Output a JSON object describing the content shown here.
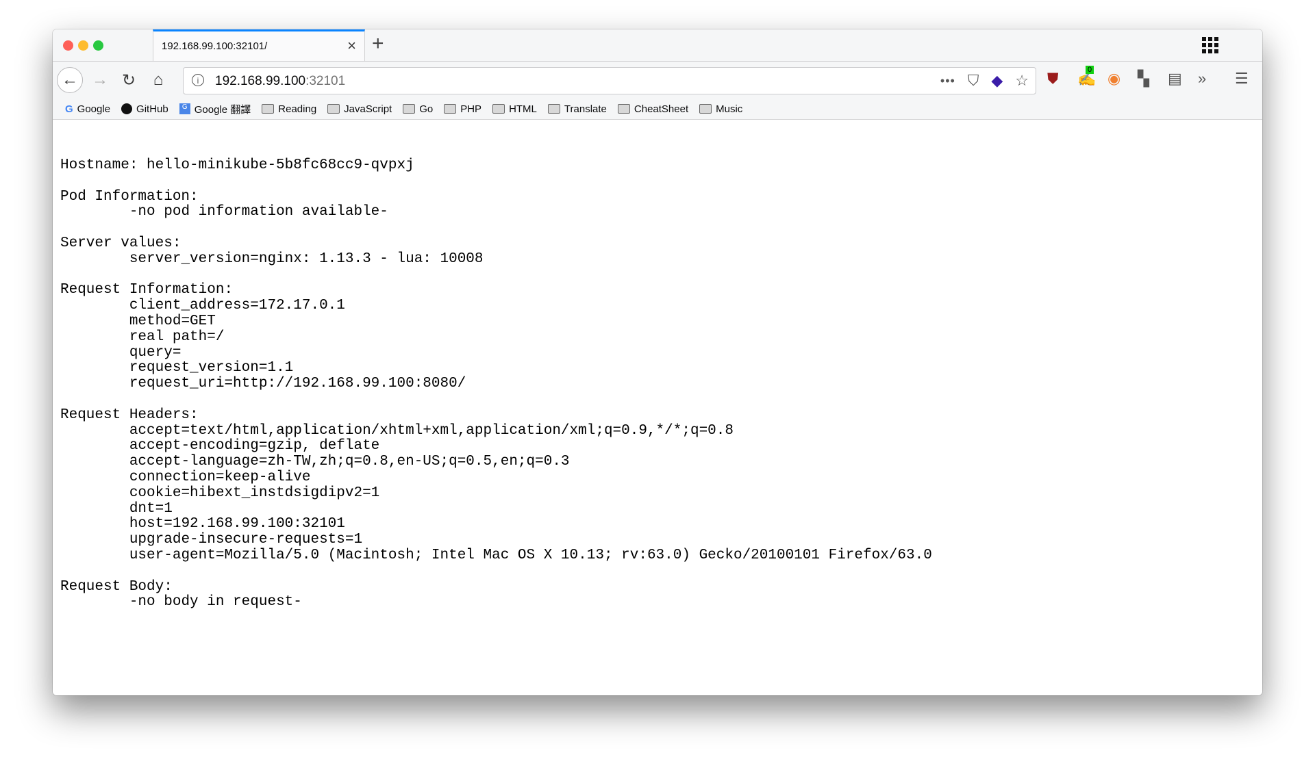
{
  "tab": {
    "title": "192.168.99.100:32101/"
  },
  "urlbar": {
    "host": "192.168.99.100",
    "port": ":32101"
  },
  "bookmarks": [
    "Google",
    "GitHub",
    "Google 翻譯",
    "Reading",
    "JavaScript",
    "Go",
    "PHP",
    "HTML",
    "Translate",
    "CheatSheet",
    "Music"
  ],
  "extension_badge": "0",
  "page": {
    "lines": [
      "Hostname: hello-minikube-5b8fc68cc9-qvpxj",
      "",
      "Pod Information:",
      "\t-no pod information available-",
      "",
      "Server values:",
      "\tserver_version=nginx: 1.13.3 - lua: 10008",
      "",
      "Request Information:",
      "\tclient_address=172.17.0.1",
      "\tmethod=GET",
      "\treal path=/",
      "\tquery=",
      "\trequest_version=1.1",
      "\trequest_uri=http://192.168.99.100:8080/",
      "",
      "Request Headers:",
      "\taccept=text/html,application/xhtml+xml,application/xml;q=0.9,*/*;q=0.8",
      "\taccept-encoding=gzip, deflate",
      "\taccept-language=zh-TW,zh;q=0.8,en-US;q=0.5,en;q=0.3",
      "\tconnection=keep-alive",
      "\tcookie=hibext_instdsigdipv2=1",
      "\tdnt=1",
      "\thost=192.168.99.100:32101",
      "\tupgrade-insecure-requests=1",
      "\tuser-agent=Mozilla/5.0 (Macintosh; Intel Mac OS X 10.13; rv:63.0) Gecko/20100101 Firefox/63.0",
      "",
      "Request Body:",
      "\t-no body in request-"
    ]
  },
  "colors": {
    "tab_accent": "#0a84ff",
    "close": "#fe5f57",
    "minimize": "#febc2e",
    "zoom": "#28c840"
  }
}
